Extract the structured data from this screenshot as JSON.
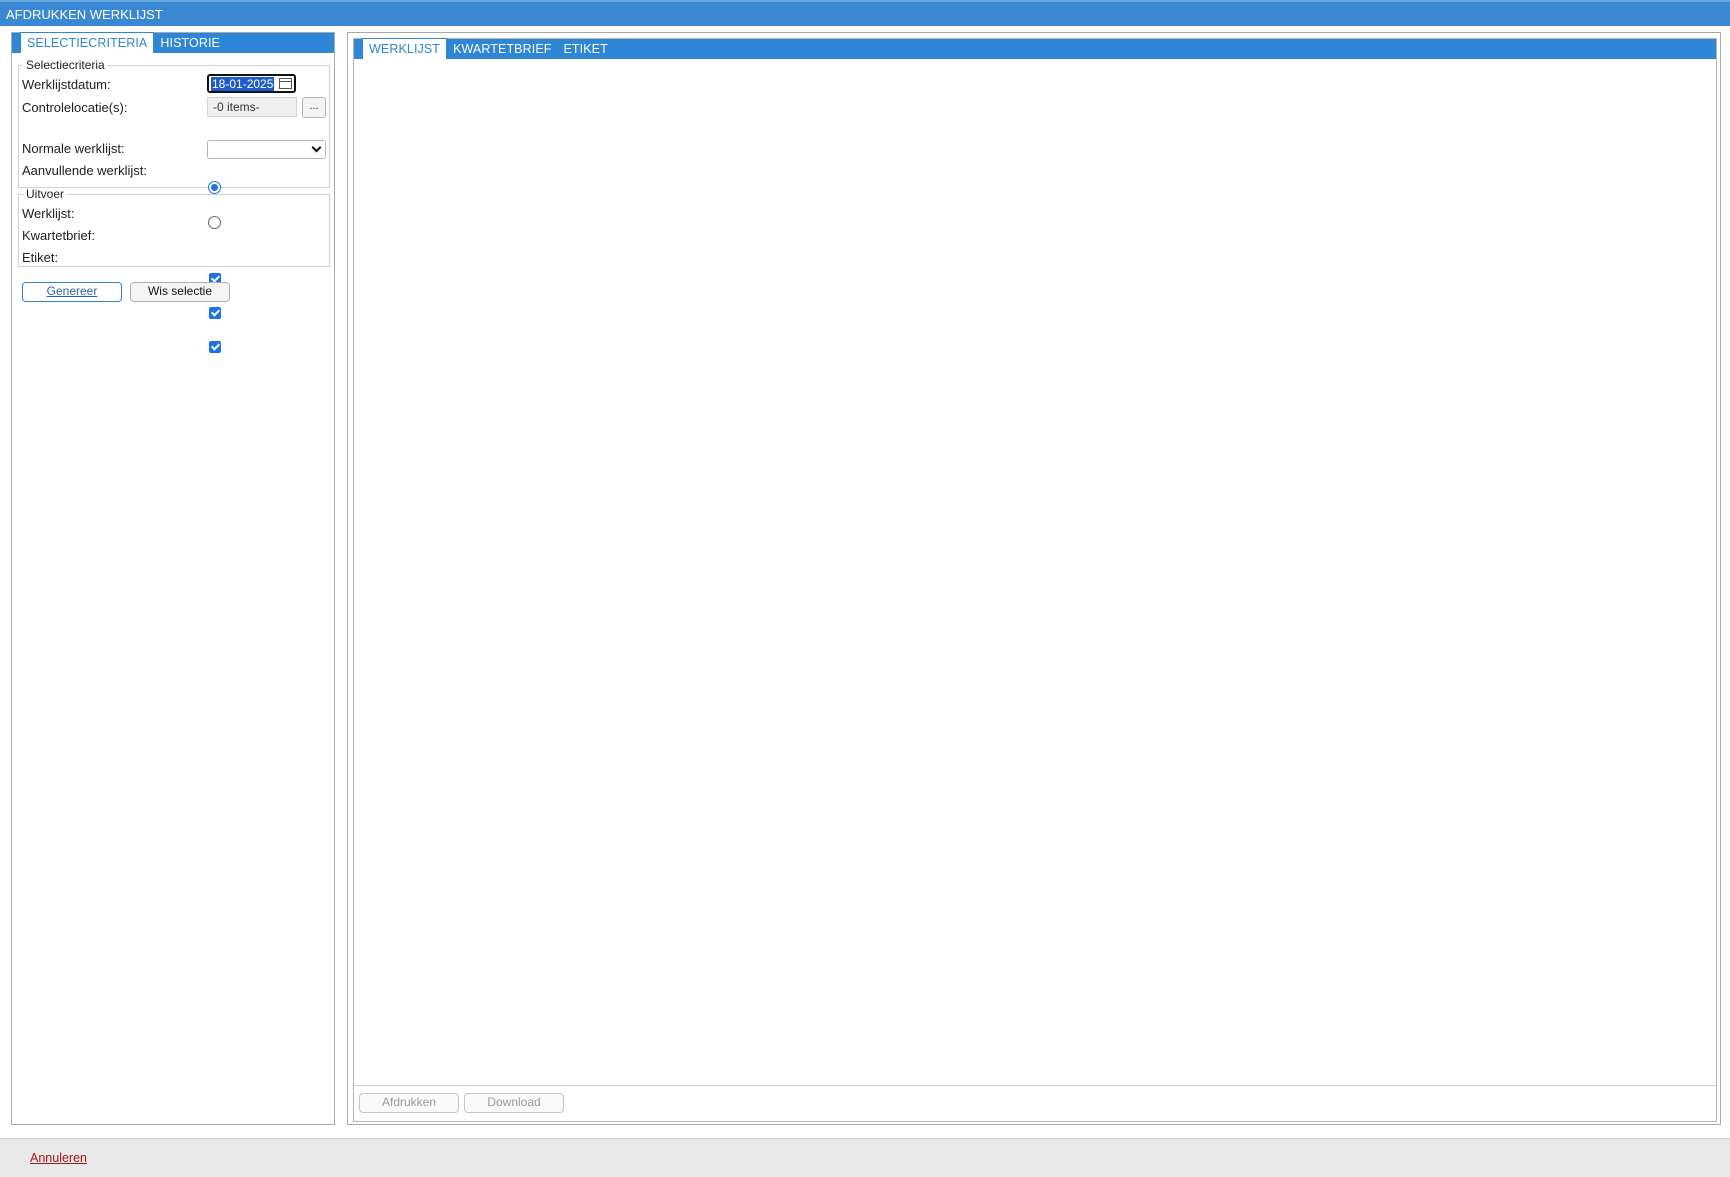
{
  "window": {
    "title": "AFDRUKKEN WERKLIJST"
  },
  "left_tabs": [
    {
      "label": "SELECTIECRITERIA",
      "active": true
    },
    {
      "label": "HISTORIE",
      "active": false
    }
  ],
  "selectiecriteria": {
    "legend": "Selectiecriteria",
    "werklijstdatum_label": "Werklijstdatum:",
    "werklijstdatum_value": "18-01-2025",
    "controlelocatie_label": "Controlelocatie(s):",
    "controlelocatie_value": "-0 items-",
    "ellipsis_label": "...",
    "dropdown_value": "",
    "normale_label": "Normale werklijst:",
    "normale_selected": true,
    "aanvullende_label": "Aanvullende werklijst:",
    "aanvullende_selected": false
  },
  "uitvoer": {
    "legend": "Uitvoer",
    "werklijst_label": "Werklijst:",
    "werklijst_checked": true,
    "kwartetbrief_label": "Kwartetbrief:",
    "kwartetbrief_checked": true,
    "etiket_label": "Etiket:",
    "etiket_checked": true
  },
  "actions": {
    "genereer_label": "Genereer",
    "wis_label": "Wis selectie"
  },
  "right_tabs": [
    {
      "label": "WERKLIJST",
      "active": true
    },
    {
      "label": "KWARTETBRIEF",
      "active": false
    },
    {
      "label": "ETIKET",
      "active": false
    }
  ],
  "viewer_actions": {
    "afdrukken_label": "Afdrukken",
    "download_label": "Download",
    "enabled": false
  },
  "footer": {
    "annuleren_label": "Annuleren"
  },
  "colors": {
    "accent": "#2e86d6",
    "title_bar": "#3a87d4",
    "cancel_link": "#a01818"
  }
}
